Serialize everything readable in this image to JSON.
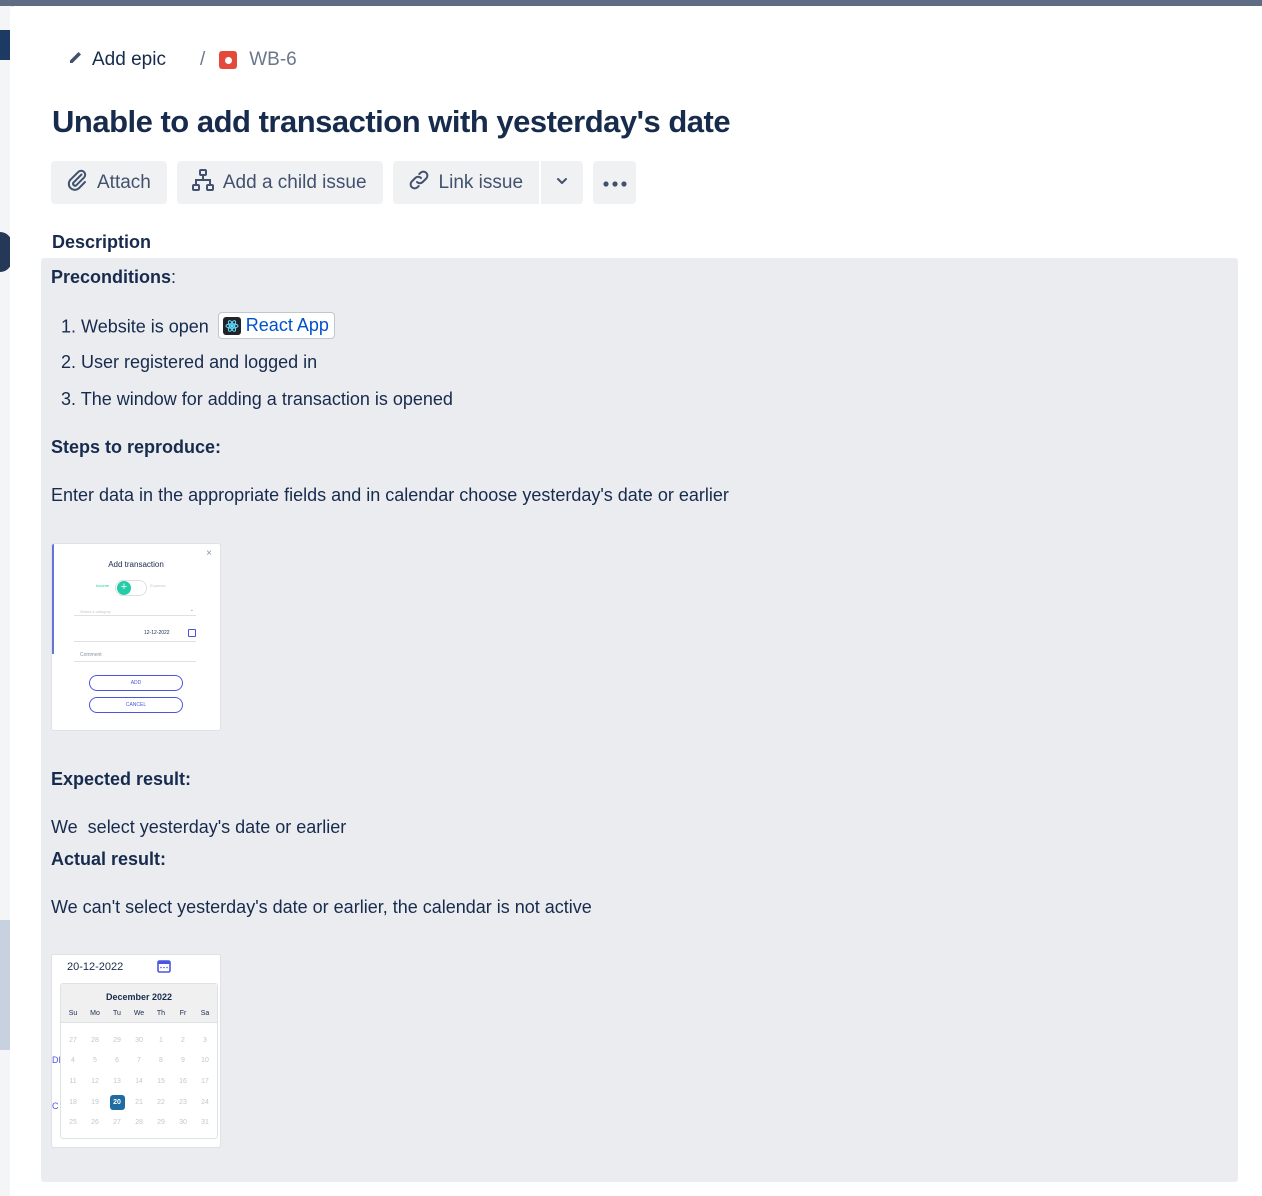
{
  "breadcrumb": {
    "add_epic_label": "Add epic",
    "separator": "/",
    "issue_key": "WB-6",
    "issue_type_icon": "bug-icon"
  },
  "issue": {
    "title": "Unable to add transaction with yesterday's date"
  },
  "toolbar": {
    "attach_label": "Attach",
    "add_child_label": "Add a child issue",
    "link_issue_label": "Link issue",
    "more_icon": "more-horizontal-icon"
  },
  "description": {
    "label": "Description",
    "preconditions_heading": "Preconditions",
    "preconditions_colon": ":",
    "preconditions": [
      {
        "num": "1.",
        "text": "Website is open"
      },
      {
        "num": "2.",
        "text": "User registered and logged in"
      },
      {
        "num": "3.",
        "text": "The window for adding a transaction is opened"
      }
    ],
    "smart_link_label": "React App",
    "steps_heading": "Steps to reproduce:",
    "steps_text": "Enter data in the appropriate fields and in calendar choose yesterday's date or earlier",
    "expected_heading": "Expected result:",
    "expected_text": "We  select yesterday's date or earlier",
    "actual_heading": "Actual result:",
    "actual_text": "We can't select yesterday's date or earlier, the calendar is not active"
  },
  "screenshot_add_transaction": {
    "title": "Add transaction",
    "toggle_left": "Income",
    "toggle_right": "Expense",
    "category_placeholder": "Select a category",
    "date_value": "12-12-2022",
    "comment_placeholder": "Comment",
    "add_button": "ADD",
    "cancel_button": "CANCEL",
    "close_glyph": "×"
  },
  "screenshot_calendar": {
    "date_value": "20-12-2022",
    "month_label": "December 2022",
    "weekdays": [
      "Su",
      "Mo",
      "Tu",
      "We",
      "Th",
      "Fr",
      "Sa"
    ],
    "weeks": [
      [
        "27",
        "28",
        "29",
        "30",
        "1",
        "2",
        "3"
      ],
      [
        "4",
        "5",
        "6",
        "7",
        "8",
        "9",
        "10"
      ],
      [
        "11",
        "12",
        "13",
        "14",
        "15",
        "16",
        "17"
      ],
      [
        "18",
        "19",
        "20",
        "21",
        "22",
        "23",
        "24"
      ],
      [
        "25",
        "26",
        "27",
        "28",
        "29",
        "30",
        "31"
      ]
    ],
    "selected_day": "20",
    "behind_fragment_1": "DD",
    "behind_fragment_2": "C"
  },
  "colors": {
    "link": "#0052cc",
    "bug": "#e5493a",
    "selected_day": "#216ba5",
    "description_bg": "#ebecf0"
  }
}
